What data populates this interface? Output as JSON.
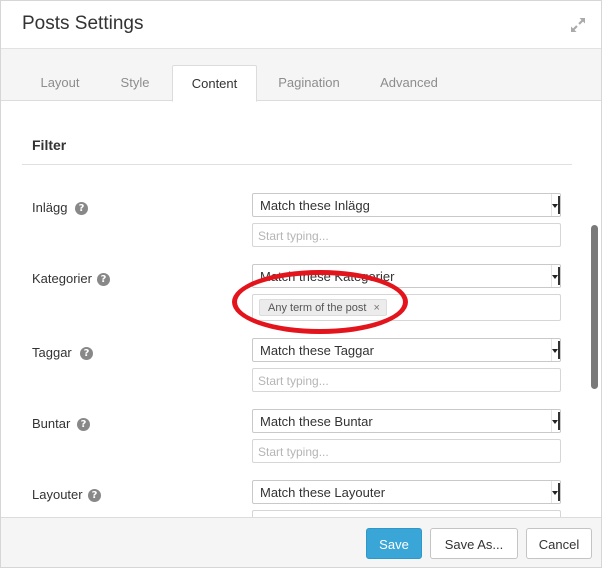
{
  "window": {
    "title": "Posts Settings",
    "expand_icon": "expand-arrows-icon"
  },
  "tabs": [
    {
      "label": "Layout",
      "active": false
    },
    {
      "label": "Style",
      "active": false
    },
    {
      "label": "Content",
      "active": true
    },
    {
      "label": "Pagination",
      "active": false
    },
    {
      "label": "Advanced",
      "active": false
    }
  ],
  "section": {
    "title": "Filter"
  },
  "filters": [
    {
      "label": "Inlägg",
      "help_icon": "?",
      "select_value": "Match these Inlägg",
      "input_placeholder": "Start typing..."
    },
    {
      "label": "Kategorier",
      "help_icon": "?",
      "select_value": "Match these Kategorier",
      "tag": "Any term of the post",
      "tag_remove": "×"
    },
    {
      "label": "Taggar",
      "help_icon": "?",
      "select_value": "Match these Taggar",
      "input_placeholder": "Start typing..."
    },
    {
      "label": "Buntar",
      "help_icon": "?",
      "select_value": "Match these Buntar",
      "input_placeholder": "Start typing..."
    },
    {
      "label": "Layouter",
      "help_icon": "?",
      "select_value": "Match these Layouter"
    }
  ],
  "annotation": {
    "shape": "oval",
    "color": "#e3141b"
  },
  "footer": {
    "save_label": "Save",
    "save_as_label": "Save As...",
    "cancel_label": "Cancel"
  },
  "colors": {
    "accent": "#3aa6d8",
    "highlight": "#e3141b"
  }
}
